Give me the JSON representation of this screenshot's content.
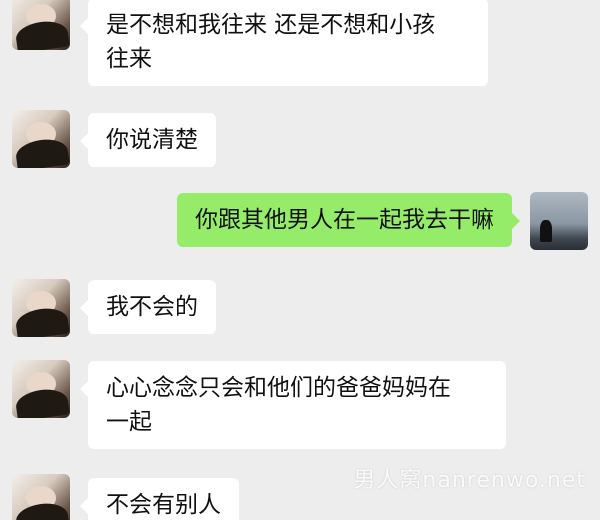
{
  "messages": [
    {
      "side": "left",
      "text": "是不想和我往来 还是不想和小孩\n往来"
    },
    {
      "side": "left",
      "text": "你说清楚"
    },
    {
      "side": "right",
      "text": "你跟其他男人在一起我去干嘛"
    },
    {
      "side": "left",
      "text": "我不会的"
    },
    {
      "side": "left",
      "text": "心心念念只会和他们的爸爸妈妈在\n一起"
    },
    {
      "side": "left",
      "text": "不会有别人"
    }
  ],
  "watermark": "男人窝nanrenwo.net",
  "colors": {
    "background": "#ededed",
    "incoming_bubble": "#ffffff",
    "outgoing_bubble": "#95ec69"
  }
}
